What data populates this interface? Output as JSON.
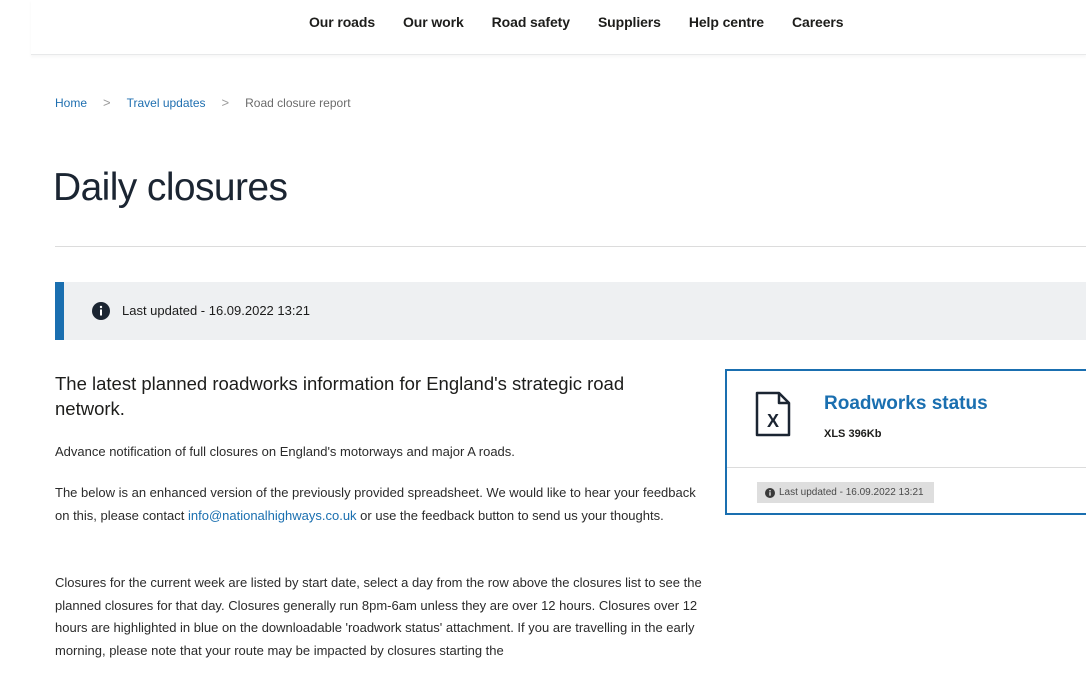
{
  "nav": {
    "items": [
      "Our roads",
      "Our work",
      "Road safety",
      "Suppliers",
      "Help centre",
      "Careers"
    ]
  },
  "breadcrumb": {
    "home": "Home",
    "travel_updates": "Travel updates",
    "current": "Road closure report",
    "separator": ">"
  },
  "page": {
    "title": "Daily closures"
  },
  "banner": {
    "icon": "info-icon",
    "text": "Last updated - 16.09.2022 13:21"
  },
  "intro": {
    "heading": "The latest planned roadworks information for England's strategic road network.",
    "p1": "Advance notification of full closures on England's motorways and major A roads.",
    "p2_before": "The below is an enhanced version of the previously provided spreadsheet. We would like to hear your feedback on this, please contact ",
    "p2_link": "info@nationalhighways.co.uk",
    "p2_after": " or use the feedback button to send us your thoughts.",
    "p3": "Closures for the current week are listed by start date, select a day from the row above the closures list to see the planned closures for that day. Closures generally run 8pm-6am unless they are over 12 hours. Closures over 12 hours are highlighted in blue on the downloadable 'roadwork status' attachment. If you are travelling in the early morning, please note that your route may be impacted by closures starting the"
  },
  "download_card": {
    "icon": "excel-file-icon",
    "icon_letter": "X",
    "title": "Roadworks status",
    "meta": "XLS 396Kb",
    "updated": "Last updated - 16.09.2022 13:21"
  },
  "colors": {
    "accent": "#1a6fb0",
    "banner_bg": "#eef0f2",
    "title_text": "#1b2532"
  }
}
